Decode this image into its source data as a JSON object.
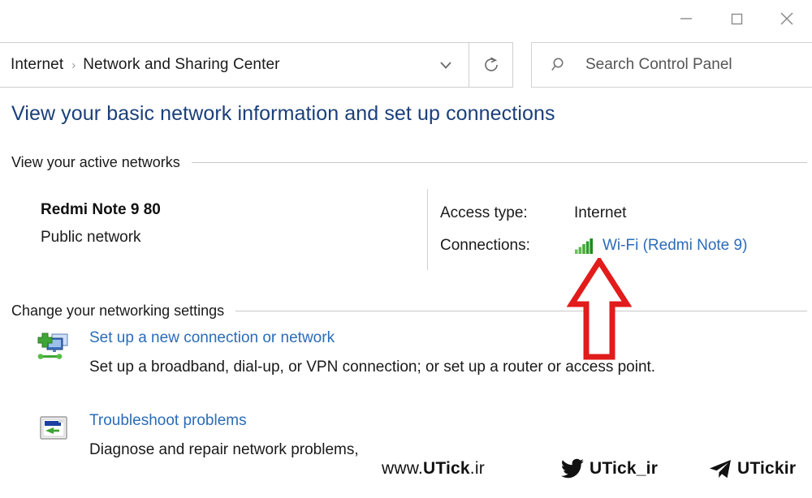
{
  "window": {
    "controls": [
      {
        "name": "minimize",
        "label": "–"
      },
      {
        "name": "maximize",
        "label": "□"
      },
      {
        "name": "close",
        "label": "✕"
      }
    ]
  },
  "navbar": {
    "breadcrumb": [
      {
        "label": "Internet"
      },
      {
        "label": "Network and Sharing Center"
      }
    ],
    "separator": "›",
    "dropdown_icon": "chevron-down-icon",
    "refresh_icon": "refresh-icon",
    "search": {
      "icon": "search-icon",
      "placeholder": "Search Control Panel",
      "value": ""
    }
  },
  "page": {
    "title": "View your basic network information and set up connections",
    "sections": {
      "active_networks": {
        "heading": "View your active networks",
        "network": {
          "name": "Redmi Note 9 80",
          "type": "Public network",
          "details": [
            {
              "key": "Access type:",
              "value": "Internet",
              "is_link": false,
              "icon": null
            },
            {
              "key": "Connections:",
              "value": "Wi-Fi (Redmi Note 9)",
              "is_link": true,
              "icon": "wifi-signal-icon"
            }
          ]
        }
      },
      "change_settings": {
        "heading": "Change your networking settings",
        "items": [
          {
            "icon": "new-connection-icon",
            "link": "Set up a new connection or network",
            "description": "Set up a broadband, dial-up, or VPN connection; or set up a router or access point."
          },
          {
            "icon": "troubleshoot-icon",
            "link": "Troubleshoot problems",
            "description": "Diagnose and repair network problems,"
          }
        ]
      }
    }
  },
  "annotation": {
    "type": "red-up-arrow",
    "color": "#e21b1b"
  },
  "watermarks": {
    "site": {
      "prefix": "www.",
      "name": "UTick",
      "suffix": ".ir"
    },
    "twitter": {
      "icon": "twitter-bird-icon",
      "handle": "UTick_ir"
    },
    "telegram": {
      "icon": "telegram-plane-icon",
      "handle": "UTickir"
    }
  },
  "colors": {
    "title_blue": "#1b3f79",
    "link_blue": "#2b6cb8",
    "accent_red": "#e21b1b",
    "signal_green": "#3fa535"
  }
}
